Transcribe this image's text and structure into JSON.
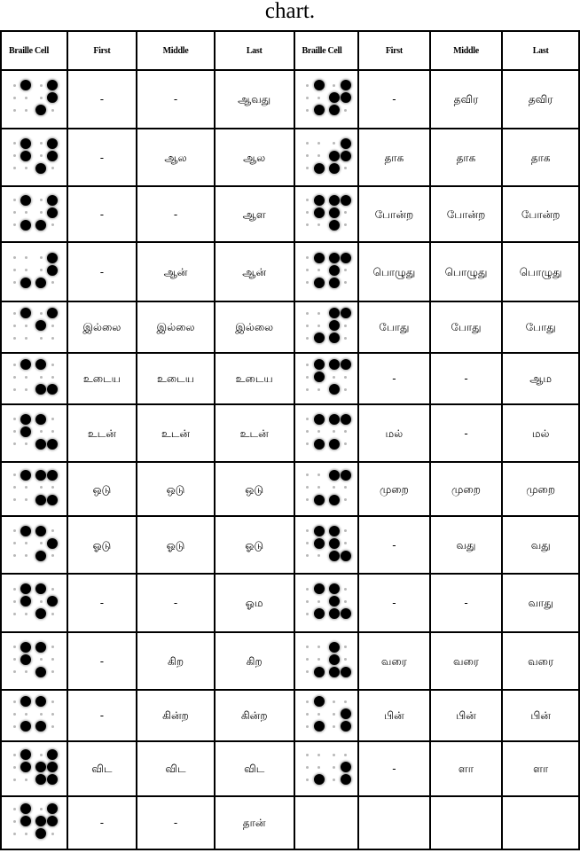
{
  "caption": "chart.",
  "headers": [
    "Braille Cell",
    "First",
    "Middle",
    "Last",
    "Braille Cell",
    "First",
    "Middle",
    "Last"
  ],
  "dot_legend": "Each braille figure: 4 columns x 3 rows (two 2x3 cells side by side); dots listed as [row, col]",
  "rows": [
    {
      "left": {
        "dots": [
          [
            0,
            1
          ],
          [
            0,
            3
          ],
          [
            1,
            3
          ],
          [
            2,
            2
          ]
        ],
        "first": "-",
        "middle": "-",
        "last": "ஆவது"
      },
      "right": {
        "dots": [
          [
            0,
            1
          ],
          [
            0,
            3
          ],
          [
            1,
            2
          ],
          [
            1,
            3
          ],
          [
            2,
            1
          ],
          [
            2,
            2
          ]
        ],
        "first": "-",
        "middle": "தவிர",
        "last": "தவிர"
      }
    },
    {
      "left": {
        "dots": [
          [
            0,
            1
          ],
          [
            0,
            3
          ],
          [
            1,
            1
          ],
          [
            1,
            3
          ],
          [
            2,
            2
          ]
        ],
        "first": "-",
        "middle": "ஆல",
        "last": "ஆல"
      },
      "right": {
        "dots": [
          [
            0,
            3
          ],
          [
            1,
            2
          ],
          [
            1,
            3
          ],
          [
            2,
            1
          ],
          [
            2,
            2
          ]
        ],
        "first": "தாக",
        "middle": "தாக",
        "last": "தாக"
      }
    },
    {
      "left": {
        "dots": [
          [
            0,
            1
          ],
          [
            0,
            3
          ],
          [
            1,
            3
          ],
          [
            2,
            1
          ],
          [
            2,
            2
          ]
        ],
        "first": "-",
        "middle": "-",
        "last": "ஆள"
      },
      "right": {
        "dots": [
          [
            0,
            1
          ],
          [
            0,
            2
          ],
          [
            0,
            3
          ],
          [
            1,
            1
          ],
          [
            1,
            2
          ],
          [
            2,
            2
          ]
        ],
        "first": "போன்ற",
        "middle": "போன்ற",
        "last": "போன்ற"
      }
    },
    {
      "left": {
        "dots": [
          [
            0,
            3
          ],
          [
            1,
            3
          ],
          [
            2,
            1
          ],
          [
            2,
            2
          ]
        ],
        "first": "-",
        "middle": "ஆன்",
        "last": "ஆன்"
      },
      "right": {
        "dots": [
          [
            0,
            1
          ],
          [
            0,
            2
          ],
          [
            0,
            3
          ],
          [
            1,
            2
          ],
          [
            2,
            1
          ],
          [
            2,
            2
          ]
        ],
        "first": "பொழுது",
        "middle": "பொழுது",
        "last": "பொழுது"
      }
    },
    {
      "left": {
        "dots": [
          [
            0,
            1
          ],
          [
            0,
            3
          ],
          [
            1,
            2
          ]
        ],
        "first": "இல்லை",
        "middle": "இல்லை",
        "last": "இல்லை"
      },
      "right": {
        "dots": [
          [
            0,
            2
          ],
          [
            0,
            3
          ],
          [
            1,
            2
          ],
          [
            2,
            1
          ],
          [
            2,
            2
          ]
        ],
        "first": "போது",
        "middle": "போது",
        "last": "போது"
      }
    },
    {
      "left": {
        "dots": [
          [
            0,
            1
          ],
          [
            0,
            2
          ],
          [
            2,
            2
          ],
          [
            2,
            3
          ]
        ],
        "first": "உடைய",
        "middle": "உடைய",
        "last": "உடைய"
      },
      "right": {
        "dots": [
          [
            0,
            1
          ],
          [
            0,
            2
          ],
          [
            0,
            3
          ],
          [
            1,
            1
          ],
          [
            2,
            2
          ]
        ],
        "first": "-",
        "middle": "-",
        "last": "ஆம"
      }
    },
    {
      "left": {
        "dots": [
          [
            0,
            1
          ],
          [
            0,
            2
          ],
          [
            1,
            1
          ],
          [
            2,
            2
          ],
          [
            2,
            3
          ]
        ],
        "first": "உடன்",
        "middle": "உடன்",
        "last": "உடன்"
      },
      "right": {
        "dots": [
          [
            0,
            1
          ],
          [
            0,
            2
          ],
          [
            0,
            3
          ],
          [
            2,
            1
          ],
          [
            2,
            2
          ]
        ],
        "first": "மல்",
        "middle": "-",
        "last": "மல்"
      }
    },
    {
      "left": {
        "dots": [
          [
            0,
            1
          ],
          [
            0,
            2
          ],
          [
            0,
            3
          ],
          [
            2,
            2
          ],
          [
            2,
            3
          ]
        ],
        "first": "ஒடு",
        "middle": "ஒடு",
        "last": "ஒடு"
      },
      "right": {
        "dots": [
          [
            0,
            2
          ],
          [
            0,
            3
          ],
          [
            2,
            1
          ],
          [
            2,
            2
          ]
        ],
        "first": "முறை",
        "middle": "முறை",
        "last": "முறை"
      }
    },
    {
      "left": {
        "dots": [
          [
            0,
            1
          ],
          [
            0,
            2
          ],
          [
            1,
            3
          ],
          [
            2,
            2
          ]
        ],
        "first": "ஓடு",
        "middle": "ஓடு",
        "last": "ஓடு"
      },
      "right": {
        "dots": [
          [
            0,
            1
          ],
          [
            0,
            2
          ],
          [
            1,
            1
          ],
          [
            1,
            2
          ],
          [
            2,
            2
          ],
          [
            2,
            3
          ]
        ],
        "first": "-",
        "middle": "வது",
        "last": "வது"
      }
    },
    {
      "left": {
        "dots": [
          [
            0,
            1
          ],
          [
            0,
            2
          ],
          [
            1,
            1
          ],
          [
            1,
            3
          ],
          [
            2,
            2
          ]
        ],
        "first": "-",
        "middle": "-",
        "last": "ஓம"
      },
      "right": {
        "dots": [
          [
            0,
            1
          ],
          [
            0,
            2
          ],
          [
            1,
            2
          ],
          [
            2,
            1
          ],
          [
            2,
            2
          ],
          [
            2,
            3
          ]
        ],
        "first": "-",
        "middle": "-",
        "last": "வாது"
      }
    },
    {
      "left": {
        "dots": [
          [
            0,
            1
          ],
          [
            0,
            2
          ],
          [
            1,
            1
          ],
          [
            2,
            2
          ]
        ],
        "first": "-",
        "middle": "கிற",
        "last": "கிற"
      },
      "right": {
        "dots": [
          [
            0,
            2
          ],
          [
            1,
            2
          ],
          [
            2,
            1
          ],
          [
            2,
            2
          ],
          [
            2,
            3
          ]
        ],
        "first": "வரை",
        "middle": "வரை",
        "last": "வரை"
      }
    },
    {
      "left": {
        "dots": [
          [
            0,
            1
          ],
          [
            0,
            2
          ],
          [
            2,
            1
          ],
          [
            2,
            2
          ]
        ],
        "first": "-",
        "middle": "கின்ற",
        "last": "கின்ற"
      },
      "right": {
        "dots": [
          [
            0,
            1
          ],
          [
            1,
            3
          ],
          [
            2,
            1
          ],
          [
            2,
            3
          ]
        ],
        "first": "பின்",
        "middle": "பின்",
        "last": "பின்"
      }
    },
    {
      "left": {
        "dots": [
          [
            0,
            1
          ],
          [
            0,
            3
          ],
          [
            1,
            1
          ],
          [
            1,
            2
          ],
          [
            1,
            3
          ],
          [
            2,
            2
          ],
          [
            2,
            3
          ]
        ],
        "first": "விட",
        "middle": "விட",
        "last": "விட"
      },
      "right": {
        "dots": [
          [
            1,
            3
          ],
          [
            2,
            1
          ],
          [
            2,
            3
          ]
        ],
        "first": "-",
        "middle": "ளா",
        "last": "ளா"
      }
    },
    {
      "left": {
        "dots": [
          [
            0,
            1
          ],
          [
            0,
            3
          ],
          [
            1,
            1
          ],
          [
            1,
            2
          ],
          [
            1,
            3
          ],
          [
            2,
            2
          ]
        ],
        "first": "-",
        "middle": "-",
        "last": "தான்"
      },
      "right": {
        "dots": [],
        "first": "",
        "middle": "",
        "last": ""
      }
    }
  ]
}
